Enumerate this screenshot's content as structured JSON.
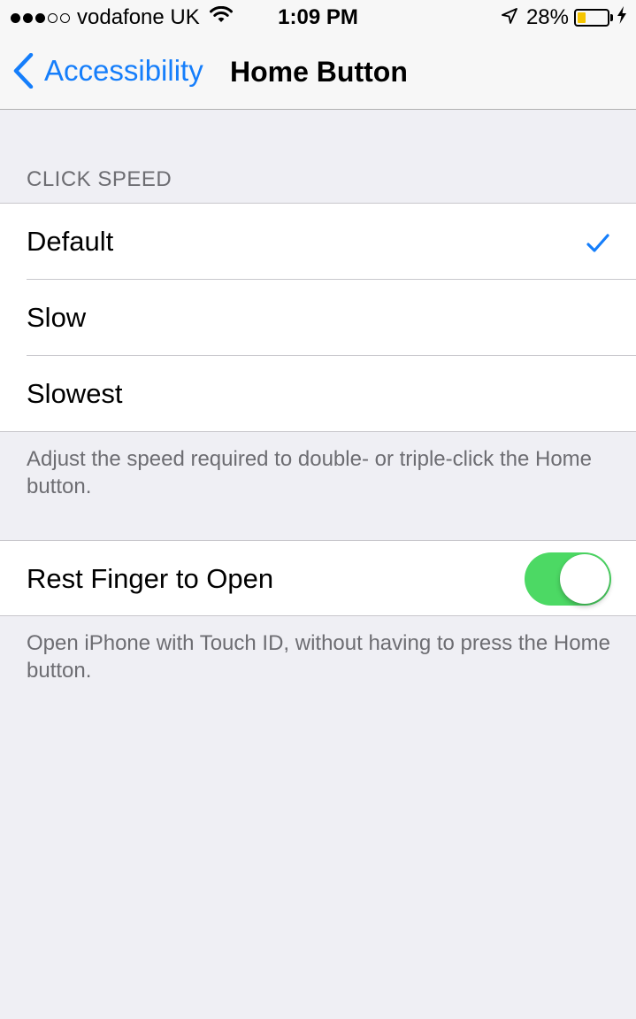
{
  "status_bar": {
    "carrier": "vodafone UK",
    "time": "1:09 PM",
    "battery_percent": "28%",
    "battery_level": 0.28,
    "signal_bars_filled": 3,
    "signal_bars_total": 5
  },
  "nav": {
    "back_label": "Accessibility",
    "title": "Home Button"
  },
  "click_speed": {
    "header": "CLICK SPEED",
    "options": [
      {
        "label": "Default",
        "selected": true
      },
      {
        "label": "Slow",
        "selected": false
      },
      {
        "label": "Slowest",
        "selected": false
      }
    ],
    "footer": "Adjust the speed required to double- or triple-click the Home button."
  },
  "rest_finger": {
    "label": "Rest Finger to Open",
    "enabled": true,
    "footer": "Open iPhone with Touch ID, without having to press the Home button."
  },
  "colors": {
    "accent": "#157efb",
    "toggle_on": "#4cd964",
    "battery_fill": "#f5c500",
    "background": "#efeff4",
    "secondary_text": "#6d6d72"
  },
  "icons": {
    "back": "chevron-left-icon",
    "check": "checkmark-icon",
    "wifi": "wifi-icon",
    "location": "location-arrow-icon",
    "charging": "lightning-bolt-icon"
  }
}
